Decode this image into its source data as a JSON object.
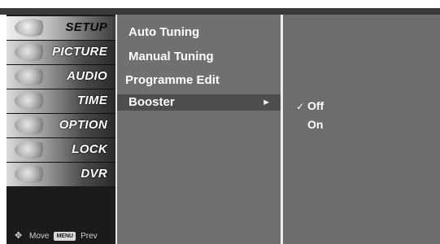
{
  "categories": [
    {
      "label": "SETUP",
      "icon": "satellite-dish-icon",
      "active": true
    },
    {
      "label": "PICTURE",
      "icon": "film-reel-icon",
      "active": false
    },
    {
      "label": "AUDIO",
      "icon": "speaker-icon",
      "active": false
    },
    {
      "label": "TIME",
      "icon": "clock-icon",
      "active": false
    },
    {
      "label": "OPTION",
      "icon": "option-tag-icon",
      "active": false
    },
    {
      "label": "LOCK",
      "icon": "lock-icon",
      "active": false
    },
    {
      "label": "DVR",
      "icon": "disc-icon",
      "active": false
    }
  ],
  "hints": {
    "move_label": "Move",
    "menu_key": "MENU",
    "prev_label": "Prev"
  },
  "submenu": [
    {
      "label": "Auto Tuning",
      "selected": false,
      "has_arrow": false
    },
    {
      "label": "Manual Tuning",
      "selected": false,
      "has_arrow": false
    },
    {
      "label": "Programme Edit",
      "selected": false,
      "has_arrow": false
    },
    {
      "label": "Booster",
      "selected": true,
      "has_arrow": true,
      "arrow": "►"
    }
  ],
  "options": [
    {
      "label": "Off",
      "checked": true,
      "check_mark": "✓"
    },
    {
      "label": "On",
      "checked": false,
      "check_mark": ""
    }
  ],
  "colors": {
    "menu_background": "#1b1b1b",
    "submenu_background": "#707070",
    "submenu_selected": "#4e4e4e",
    "options_background": "#6d6d6d"
  }
}
